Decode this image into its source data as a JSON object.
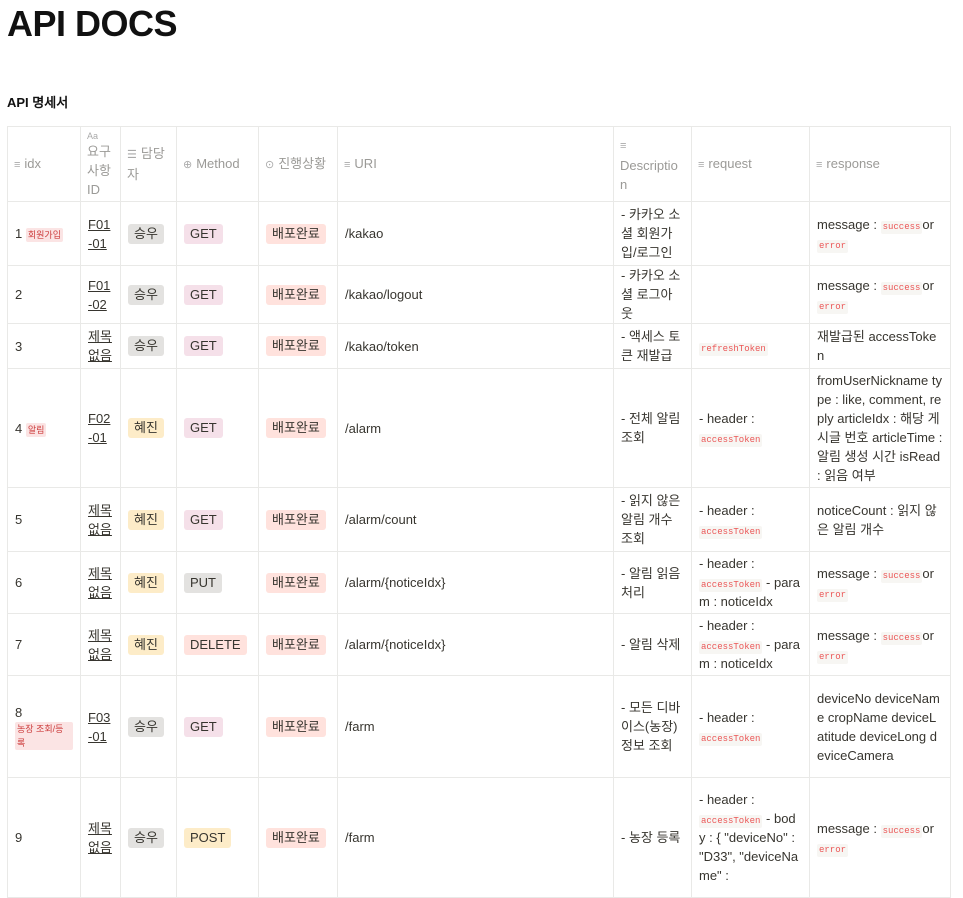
{
  "page": {
    "title": "API DOCS",
    "subtitle": "API 명세서"
  },
  "columns": {
    "idx": "idx",
    "req_id": "요구사항ID",
    "owner": "담당자",
    "method": "Method",
    "status": "진행상황",
    "uri": "URI",
    "description": "Description",
    "request": "request",
    "response": "response"
  },
  "column_icons": {
    "idx": "text-lines-icon",
    "req_id": "title-aa-icon",
    "owner": "list-icon",
    "method": "select-circle-icon",
    "status": "select-circle-icon",
    "uri": "text-lines-icon",
    "description": "text-lines-icon",
    "request": "text-lines-icon",
    "response": "text-lines-icon"
  },
  "rows": [
    {
      "idx": "1",
      "tag": "회원가입",
      "req": "F01-01",
      "owner": "승우",
      "method": "GET",
      "status": "배포완료",
      "uri": "/kakao",
      "desc": "- 카카오 소셜 회원가입/로그인",
      "request": "",
      "resp_pre": "message : ",
      "resp_code1": "success",
      "resp_mid": "or ",
      "resp_code2": "error"
    },
    {
      "idx": "2",
      "tag": "",
      "req": "F01-02",
      "owner": "승우",
      "method": "GET",
      "status": "배포완료",
      "uri": "/kakao/logout",
      "desc": "- 카카오 소셜 로그아웃",
      "request": "",
      "resp_pre": "message : ",
      "resp_code1": "success",
      "resp_mid": "or ",
      "resp_code2": "error"
    },
    {
      "idx": "3",
      "tag": "",
      "req": "제목 없음",
      "owner": "승우",
      "method": "GET",
      "status": "배포완료",
      "uri": "/kakao/token",
      "desc": "- 액세스 토큰 재발급",
      "request_code": "refreshToken",
      "response": "재발급된 accessToken"
    },
    {
      "idx": "4",
      "tag": "알림",
      "req": "F02-01",
      "owner": "혜진",
      "method": "GET",
      "status": "배포완료",
      "uri": "/alarm",
      "desc": "- 전체 알림 조회",
      "req_pre": "- header : ",
      "req_code": "accessToken",
      "response": "fromUserNickname type : like, comment, reply articleIdx : 해당 게시글 번호 articleTime : 알림 생성 시간 isRead : 읽음 여부"
    },
    {
      "idx": "5",
      "tag": "",
      "req": "제목 없음",
      "owner": "혜진",
      "method": "GET",
      "status": "배포완료",
      "uri": "/alarm/count",
      "desc": "- 읽지 않은 알림 개수 조회",
      "req_pre": "- header : ",
      "req_code": "accessToken",
      "response": "noticeCount : 읽지 않은 알림 개수"
    },
    {
      "idx": "6",
      "tag": "",
      "req": "제목 없음",
      "owner": "혜진",
      "method": "PUT",
      "status": "배포완료",
      "uri": "/alarm/{noticeIdx}",
      "desc": "- 알림 읽음 처리",
      "req_pre": "- header : ",
      "req_code": "accessToken",
      "req_post": " - param : noticeIdx",
      "resp_pre": "message : ",
      "resp_code1": "success",
      "resp_mid": "or ",
      "resp_code2": "error"
    },
    {
      "idx": "7",
      "tag": "",
      "req": "제목 없음",
      "owner": "혜진",
      "method": "DELETE",
      "status": "배포완료",
      "uri": "/alarm/{noticeIdx}",
      "desc": "- 알림 삭제",
      "req_pre": "- header : ",
      "req_code": "accessToken",
      "req_post": " - param : noticeIdx",
      "resp_pre": "message : ",
      "resp_code1": "success",
      "resp_mid": "or ",
      "resp_code2": "error"
    },
    {
      "idx": "8",
      "tag": "농장 조회/등록",
      "req": "F03-01",
      "owner": "승우",
      "method": "GET",
      "status": "배포완료",
      "uri": "/farm",
      "desc": "- 모든 디바이스(농장) 정보 조회",
      "req_pre": "- header : ",
      "req_code": "accessToken",
      "response": "deviceNo deviceName cropName deviceLatitude deviceLong deviceCamera"
    },
    {
      "idx": "9",
      "tag": "",
      "req": "제목 없음",
      "owner": "승우",
      "method": "POST",
      "status": "배포완료",
      "uri": "/farm",
      "desc": "- 농장 등록",
      "req_pre": "- header : ",
      "req_code": "accessToken",
      "req_post": " - body : { \"deviceNo\" : \"D33\", \"deviceName\" :",
      "resp_pre": "message : ",
      "resp_code1": "success",
      "resp_mid": "or ",
      "resp_code2": "error"
    }
  ],
  "colors": {
    "gray_pill": "#e3e2e0",
    "yellow_pill": "#fdecc8",
    "pink_pill": "#f5e0e9",
    "red_pill": "#ffe2dd",
    "orange_pill": "#fadec9",
    "code_text": "#eb5757"
  }
}
